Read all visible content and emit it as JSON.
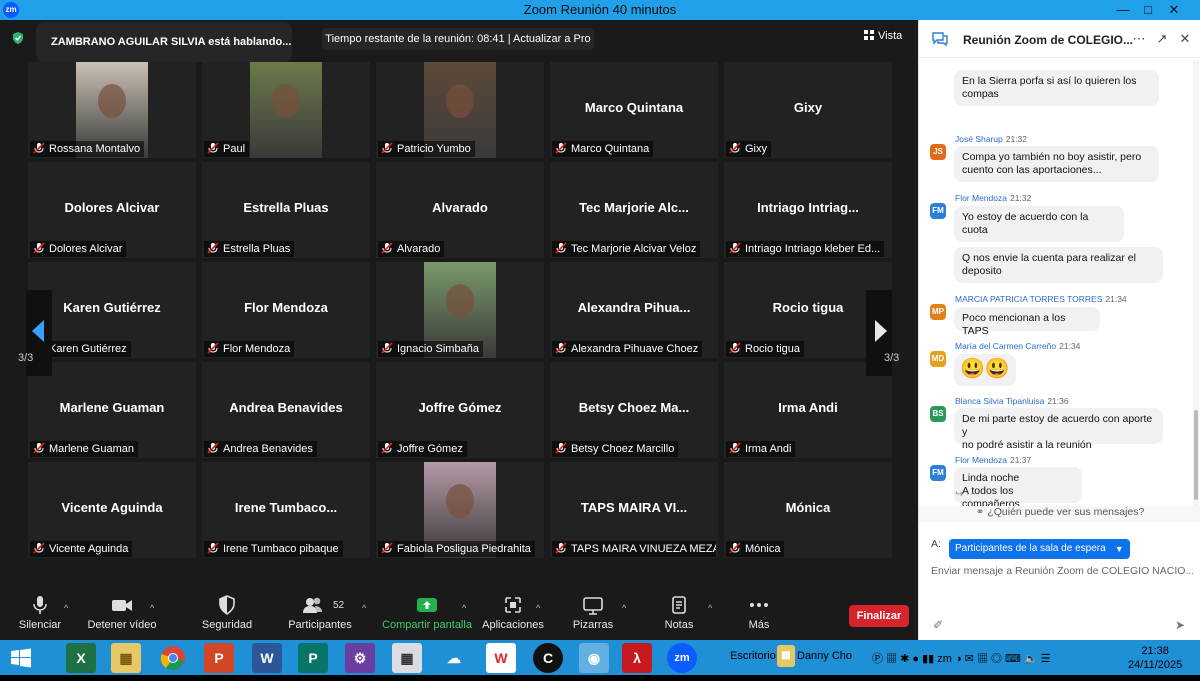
{
  "window": {
    "title": "Zoom Reunión 40 minutos",
    "logo_text": "zm"
  },
  "meeting": {
    "speaking": "ZAMBRANO AGUILAR SILVIA está hablando...",
    "timer": "Tiempo restante de la reunión: 08:41 | Actualizar a Pro",
    "view_label": "Vista",
    "page_left": "3/3",
    "page_right": "3/3",
    "tiles": [
      {
        "center": "",
        "label": "Rossana Montalvo",
        "photo": "#c9c1b4"
      },
      {
        "center": "",
        "label": "Paul",
        "photo": "#6c7a4a"
      },
      {
        "center": "",
        "label": "Patricio Yumbo",
        "photo": "#5d4a3a"
      },
      {
        "center": "Marco Quintana",
        "label": "Marco Quintana"
      },
      {
        "center": "Gixy",
        "label": "Gixy"
      },
      {
        "center": "Dolores Alcivar",
        "label": "Dolores Alcivar"
      },
      {
        "center": "Estrella Pluas",
        "label": "Estrella Pluas"
      },
      {
        "center": "Alvarado",
        "label": "Alvarado"
      },
      {
        "center": "Tec Marjorie Alc...",
        "label": "Tec Marjorie Alcivar Veloz"
      },
      {
        "center": "Intriago Intriag...",
        "label": "Intriago Intriago kleber Ed..."
      },
      {
        "center": "Karen Gutiérrez",
        "label": "Karen Gutiérrez"
      },
      {
        "center": "Flor Mendoza",
        "label": "Flor Mendoza"
      },
      {
        "center": "",
        "label": "Ignacio Simbaña",
        "photo": "#7a9a6a"
      },
      {
        "center": "Alexandra Pihua...",
        "label": "Alexandra Pihuave Choez"
      },
      {
        "center": "Rocio tigua",
        "label": "Rocio tigua"
      },
      {
        "center": "Marlene Guaman",
        "label": "Marlene Guaman"
      },
      {
        "center": "Andrea Benavides",
        "label": "Andrea Benavides"
      },
      {
        "center": "Joffre Gómez",
        "label": "Joffre Gómez"
      },
      {
        "center": "Betsy Choez Ma...",
        "label": "Betsy Choez Marcillo"
      },
      {
        "center": "Irma Andi",
        "label": "Irma Andi"
      },
      {
        "center": "Vicente Aguinda",
        "label": "Vicente Aguinda"
      },
      {
        "center": "Irene Tumbaco...",
        "label": "Irene Tumbaco pibaque"
      },
      {
        "center": "",
        "label": "Fabiola Posligua Piedrahita",
        "photo": "#b59aa8"
      },
      {
        "center": "TAPS MAIRA VI...",
        "label": "TAPS MAIRA VINUEZA MEZA"
      },
      {
        "center": "Mónica",
        "label": "Mónica"
      }
    ]
  },
  "toolbar": {
    "mute": "Silenciar",
    "video": "Detener vídeo",
    "security": "Seguridad",
    "participants": "Participantes",
    "participants_count": "52",
    "share": "Compartir pantalla",
    "apps": "Aplicaciones",
    "whiteboards": "Pizarras",
    "notes": "Notas",
    "more": "Más",
    "end": "Finalizar"
  },
  "chat": {
    "title": "Reunión Zoom de COLEGIO...",
    "messages": [
      {
        "type": "bubble",
        "text1": "En la Sierra porfa si así lo quieren los",
        "text2": "compas"
      },
      {
        "type": "header",
        "initials": "JS",
        "color": "#e06b1a",
        "name": "José Sharup",
        "time": "21:32"
      },
      {
        "type": "bubble",
        "text1": "Compa yo también no boy asistir, pero",
        "text2": "cuento con las aportaciones..."
      },
      {
        "type": "header",
        "initials": "FM",
        "color": "#2d7fd6",
        "name": "Flor Mendoza",
        "time": "21:32"
      },
      {
        "type": "bubble",
        "text1": "Yo estoy de acuerdo con la cuota",
        "text2": ""
      },
      {
        "type": "bubble",
        "text1": "Q nos envie la cuenta para realizar el",
        "text2": "deposito"
      },
      {
        "type": "header",
        "initials": "MP",
        "color": "#e0801a",
        "name": "MARCIA PATRICIA TORRES TORRES",
        "time": "21:34"
      },
      {
        "type": "bubble",
        "text1": "Poco mencionan a los TAPS",
        "text2": ""
      },
      {
        "type": "header",
        "initials": "MD",
        "color": "#e8a020",
        "name": "María del Carmen Carreño",
        "time": "21:34"
      },
      {
        "type": "bubble",
        "text1": "😃😃",
        "text2": ""
      },
      {
        "type": "header",
        "initials": "BS",
        "color": "#2a9a5a",
        "name": "Blanca Silvia Tipanluisa",
        "time": "21:36"
      },
      {
        "type": "bubble",
        "text1": "De mi parte estoy de acuerdo con aporte y",
        "text2": "no podré asistir a la reunión"
      },
      {
        "type": "header",
        "initials": "FM",
        "color": "#2d7fd6",
        "name": "Flor Mendoza",
        "time": "21:37"
      },
      {
        "type": "bubble",
        "text1": "Linda noche",
        "text2": "A todos los compañeros"
      }
    ],
    "who_can_see": "¿Quién puede ver sus mensajes?",
    "to_label": "A:",
    "to_value": "Participantes de la sala de espera",
    "input_placeholder": "Enviar mensaje a Reunión Zoom de COLEGIO NACIO..."
  },
  "taskbar": {
    "desktop_label": "Escritorio",
    "user_label": "Danny Cho",
    "time": "21:38",
    "date": "24/11/2025"
  }
}
